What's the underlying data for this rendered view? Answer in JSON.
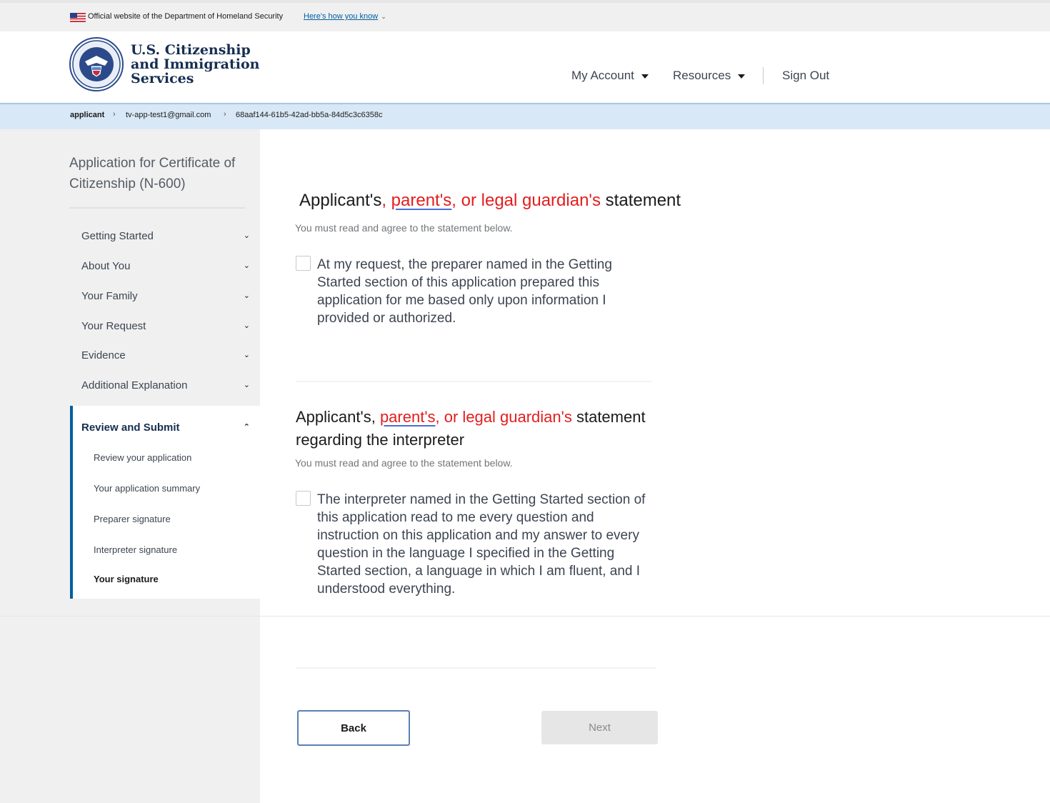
{
  "gov_banner": {
    "official_text": "Official website of the Department of Homeland Security",
    "how_you_know": "Here's how you know"
  },
  "header": {
    "agency_lines": [
      "U.S. Citizenship",
      "and Immigration",
      "Services"
    ],
    "nav": {
      "my_account": "My Account",
      "resources": "Resources",
      "sign_out": "Sign Out"
    }
  },
  "breadcrumb": {
    "items": [
      "applicant",
      "tv-app-test1@gmail.com",
      "68aaf144-61b5-42ad-bb5a-84d5c3c6358c"
    ]
  },
  "sidebar": {
    "title": "Application for Certificate of Citizenship (N-600)",
    "sections": [
      "Getting Started",
      "About You",
      "Your Family",
      "Your Request",
      "Evidence",
      "Additional Explanation"
    ],
    "active_section": "Review and Submit",
    "subitems": [
      "Review your application",
      "Your application summary",
      "Preparer signature",
      "Interpreter signature",
      "Your signature"
    ]
  },
  "main": {
    "statement1": {
      "title_pre": "Applicant's",
      "title_comma1": ", ",
      "title_parents": "parent's",
      "title_or": ", or legal guardian's",
      "title_post": " statement",
      "hint": "You must read and agree to the statement below.",
      "checkbox_text": "At my request, the preparer named in the Getting Started section of this application prepared this application for me based only upon information I provided or authorized."
    },
    "statement2": {
      "title_pre": "Applicant's, ",
      "title_parents": "parent's",
      "title_or": ", or legal guardian's",
      "title_post": " statement regarding the interpreter",
      "hint": "You must read and agree to the statement below.",
      "checkbox_text": "The interpreter named in the Getting Started section of this application read to me every question and instruction on this application and my answer to every question in the language I specified in the Getting Started section, a language in which I am fluent, and I understood everything."
    },
    "buttons": {
      "back": "Back",
      "next": "Next"
    }
  }
}
